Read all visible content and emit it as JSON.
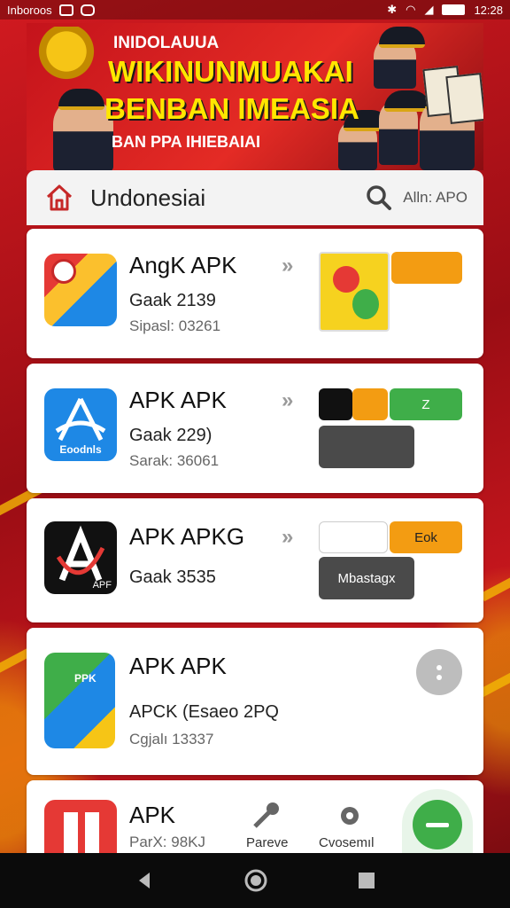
{
  "status_bar": {
    "carrier": "Inboroos",
    "time": "12:28"
  },
  "banner": {
    "line1": "INIDOLAUUA",
    "line2": "WIKINUNMUAKAI",
    "line3": "BENBAN IMEASIA",
    "line4": "BAN PPA IHIEBAIAI"
  },
  "header": {
    "title": "Undonesiai",
    "search_label": "Alln: APO"
  },
  "apps": [
    {
      "title": "AngK APK",
      "line1": "Gaak 2139",
      "line2": "Sipasl: 03261",
      "btn_label": ""
    },
    {
      "title": "APK APK",
      "line1": "Gaak 229)",
      "line2": "Sarak: 36061",
      "icon_text": "Eoodnls",
      "btn_label": "Z"
    },
    {
      "title": "APK APKG",
      "line1": "Gaak 3535",
      "line2": "",
      "icon_text": "APF",
      "btn_label": "Eok",
      "btn2_label": "Mbastagx"
    },
    {
      "title": "APK APK",
      "line1": "APCK (Esaeo 2PQ",
      "line2": "Cgjalı 13337",
      "icon_text": "PPK"
    },
    {
      "title": "APK",
      "line1": "ParX: 98KJ",
      "line2": ""
    }
  ],
  "bottom_nav": {
    "item1": "Pareve",
    "item2": "Cvosemıl"
  },
  "colors": {
    "accent": "#f39c12",
    "green": "#3fae49",
    "dark": "#4a4a4a"
  }
}
